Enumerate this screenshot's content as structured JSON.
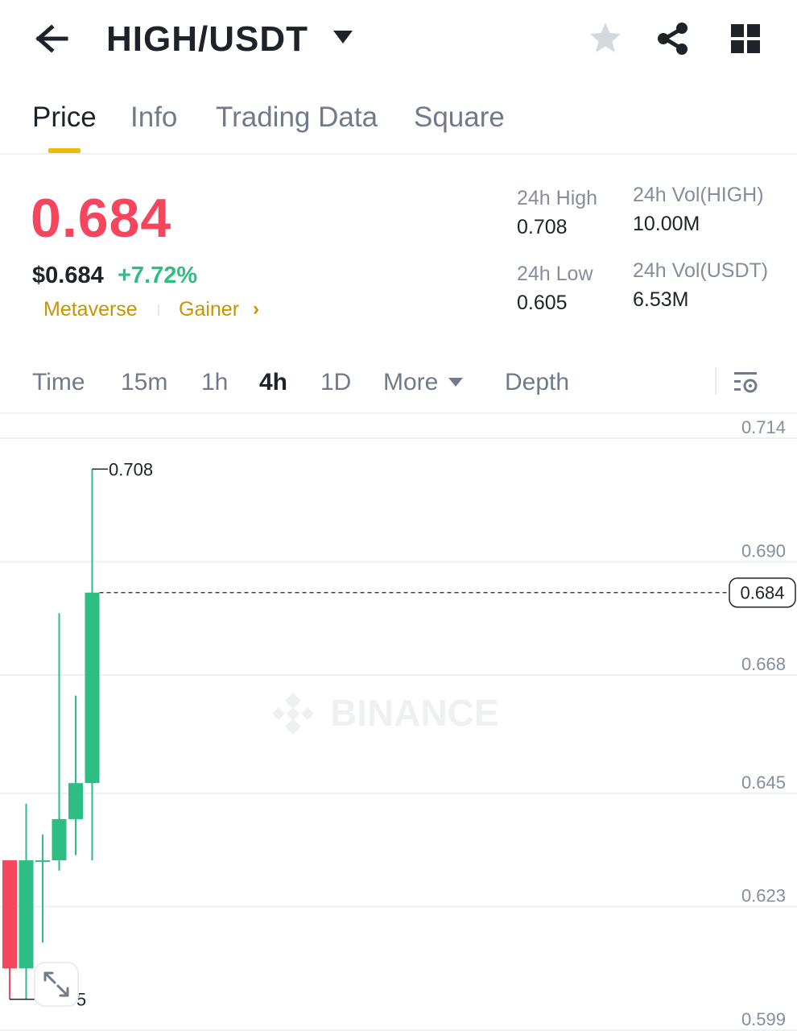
{
  "header": {
    "pair": "HIGH/USDT"
  },
  "tabs": [
    {
      "label": "Price",
      "active": true
    },
    {
      "label": "Info",
      "active": false
    },
    {
      "label": "Trading Data",
      "active": false
    },
    {
      "label": "Square",
      "active": false
    }
  ],
  "price": {
    "last": "0.684",
    "usd": "$0.684",
    "change": "+7.72%",
    "tags": [
      "Metaverse",
      "Gainer"
    ],
    "tag_arrow": "›"
  },
  "stats": {
    "high_label": "24h High",
    "high_value": "0.708",
    "low_label": "24h Low",
    "low_value": "0.605",
    "vol_base_label": "24h Vol(HIGH)",
    "vol_base_value": "10.00M",
    "vol_quote_label": "24h Vol(USDT)",
    "vol_quote_value": "6.53M"
  },
  "intervals": {
    "items": [
      "Time",
      "15m",
      "1h",
      "4h",
      "1D",
      "More",
      "Depth"
    ],
    "active": "4h"
  },
  "watermark": "BINANCE",
  "colors": {
    "up": "#2ebd85",
    "down": "#f6465d",
    "accent": "#f0b90b",
    "tag": "#c99400"
  },
  "chart_data": {
    "type": "candlestick",
    "interval": "4h",
    "y_ticks": [
      "0.714",
      "0.690",
      "0.668",
      "0.645",
      "0.623",
      "0.599"
    ],
    "ylim": [
      0.599,
      0.714
    ],
    "current_price": "0.684",
    "high_marker": "0.708",
    "low_marker": "0.605",
    "candles": [
      {
        "open": 0.611,
        "high": 0.627,
        "low": 0.605,
        "close": 0.632,
        "dir": "down"
      },
      {
        "open": 0.611,
        "high": 0.643,
        "low": 0.605,
        "close": 0.632,
        "dir": "up"
      },
      {
        "open": 0.632,
        "high": 0.637,
        "low": 0.616,
        "close": 0.632,
        "dir": "up"
      },
      {
        "open": 0.632,
        "high": 0.68,
        "low": 0.63,
        "close": 0.64,
        "dir": "up"
      },
      {
        "open": 0.64,
        "high": 0.664,
        "low": 0.633,
        "close": 0.647,
        "dir": "up"
      },
      {
        "open": 0.647,
        "high": 0.708,
        "low": 0.632,
        "close": 0.684,
        "dir": "up"
      }
    ]
  }
}
